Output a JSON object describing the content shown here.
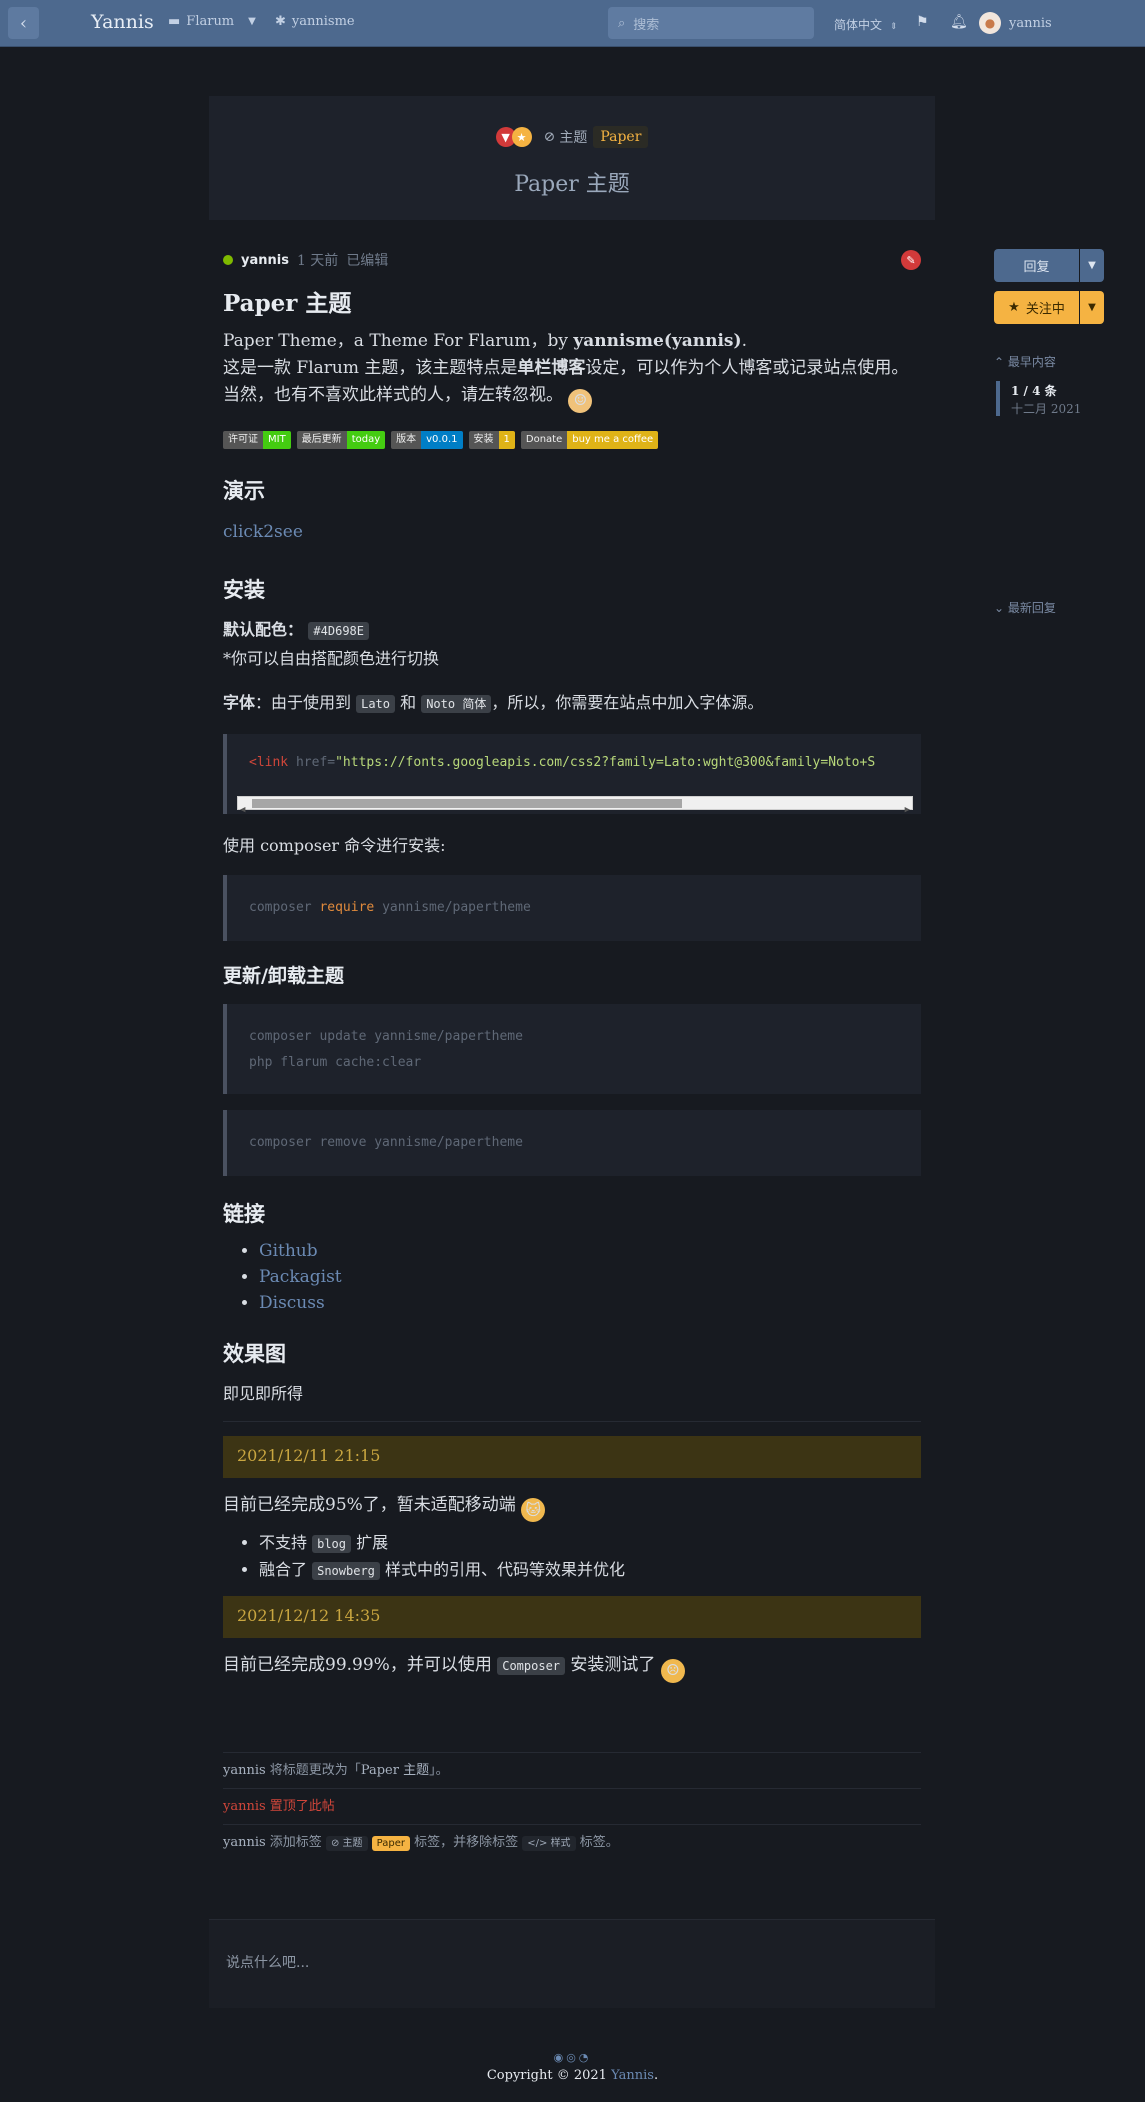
{
  "header": {
    "brand": "Yannis",
    "nav_flarum": "Flarum",
    "nav_yannisme": "yannisme",
    "search_placeholder": "搜索",
    "language": "简体中文",
    "username": "yannis"
  },
  "hero": {
    "tag_main": "主题",
    "tag_paper": "Paper",
    "title": "Paper 主题"
  },
  "post": {
    "author": "yannis",
    "time": "1 天前",
    "edited": "已编辑",
    "title": "Paper 主题",
    "intro_1_prefix": "Paper Theme，a Theme For Flarum，by ",
    "intro_1_bold": "yannisme(yannis)",
    "intro_1_suffix": ".",
    "intro_2_prefix": "这是一款 Flarum 主题，该主题特点是",
    "intro_2_bold": "单栏博客",
    "intro_2_suffix": "设定，可以作为个人博客或记录站点使用。",
    "intro_3": "当然，也有不喜欢此样式的人，请左转忽视。",
    "shields": [
      {
        "label": "许可证",
        "value": "MIT",
        "color": "#4c1"
      },
      {
        "label": "最后更新",
        "value": "today",
        "color": "#4c1"
      },
      {
        "label": "版本",
        "value": "v0.0.1",
        "color": "#007ec6"
      },
      {
        "label": "安装",
        "value": "1",
        "color": "#dfb317"
      },
      {
        "label": "Donate",
        "value": "buy me a coffee",
        "color": "#dfb317"
      }
    ],
    "h_demo": "演示",
    "demo_link": "click2see",
    "h_install": "安装",
    "default_color_label": "默认配色：",
    "default_color_value": "#4D698E",
    "color_note": "*你可以自由搭配颜色进行切换",
    "font_label": "字体",
    "font_text_1": "：由于使用到 ",
    "font_lato": "Lato",
    "font_and": " 和 ",
    "font_noto": "Noto 简体",
    "font_text_2": "，所以，你需要在站点中加入字体源。",
    "code_link_tag": "link",
    "code_link_attr": "href",
    "code_link_value": "\"https://fonts.googleapis.com/css2?family=Lato:wght@300&family=Noto+S",
    "composer_intro": "使用 composer 命令进行安装:",
    "code_install_a": "composer ",
    "code_install_b": "require",
    "code_install_c": " yannisme/papertheme",
    "h_update": "更新/卸载主题",
    "code_update_1": "composer update yannisme/papertheme",
    "code_update_2": "php flarum cache:clear",
    "code_remove": "composer remove yannisme/papertheme",
    "h_links": "链接",
    "links": [
      "Github",
      "Packagist",
      "Discuss"
    ],
    "h_screenshots": "效果图",
    "wysiwyg": "即见即所得",
    "date_1": "2021/12/11 21:15",
    "progress_1": "目前已经完成95%了，暂未适配移动端",
    "bullet_1_a": "不支持 ",
    "bullet_1_code": "blog",
    "bullet_1_b": " 扩展",
    "bullet_2_a": "融合了 ",
    "bullet_2_code": "Snowberg",
    "bullet_2_b": " 样式中的引用、代码等效果并优化",
    "date_2": "2021/12/12 14:35",
    "progress_2_a": "目前已经完成99.99%，并可以使用 ",
    "progress_2_code": "Composer",
    "progress_2_b": " 安装测试了"
  },
  "events": {
    "e1_user": "yannis",
    "e1_text": " 将标题更改为「",
    "e1_title": "Paper 主题",
    "e1_end": "」。",
    "e2_user": "yannis",
    "e2_text": " 置顶了此帖",
    "e3_user": "yannis",
    "e3_text": " 添加标签 ",
    "e3_tag1": "主题",
    "e3_tag2": "Paper",
    "e3_mid": " 标签，并移除标签 ",
    "e3_tag3": "样式",
    "e3_end": " 标签。"
  },
  "reply_placeholder": "说点什么吧...",
  "sidebar": {
    "reply": "回复",
    "follow": "关注中",
    "first": "最早内容",
    "count": "1 / 4 条",
    "date": "十二月 2021",
    "last": "最新回复"
  },
  "footer": {
    "copyright": "Copyright © 2021 ",
    "owner": "Yannis",
    "period": "."
  },
  "colors": {
    "primary": "#4D698E",
    "accent": "#F5B342",
    "danger": "#D23A3A"
  }
}
